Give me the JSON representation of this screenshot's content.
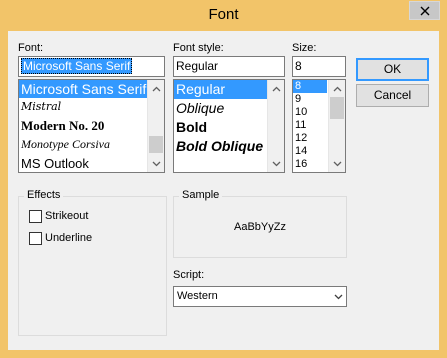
{
  "window": {
    "title": "Font"
  },
  "font": {
    "label": "Font:",
    "value": "Microsoft Sans Serif",
    "items": [
      "Microsoft Sans Serif",
      "Mistral",
      "Modern No. 20",
      "Monotype Corsiva",
      "MS Outlook"
    ]
  },
  "style": {
    "label": "Font style:",
    "value": "Regular",
    "items": [
      "Regular",
      "Oblique",
      "Bold",
      "Bold Oblique"
    ]
  },
  "size": {
    "label": "Size:",
    "value": "8",
    "items": [
      "8",
      "9",
      "10",
      "11",
      "12",
      "14",
      "16"
    ]
  },
  "buttons": {
    "ok": "OK",
    "cancel": "Cancel"
  },
  "effects": {
    "title": "Effects",
    "strikeout": "Strikeout",
    "underline": "Underline"
  },
  "sample": {
    "title": "Sample",
    "text": "AaBbYyZz"
  },
  "script": {
    "label": "Script:",
    "value": "Western"
  },
  "colors": {
    "titlebar": "#f2c469",
    "selection": "#3399ff"
  }
}
